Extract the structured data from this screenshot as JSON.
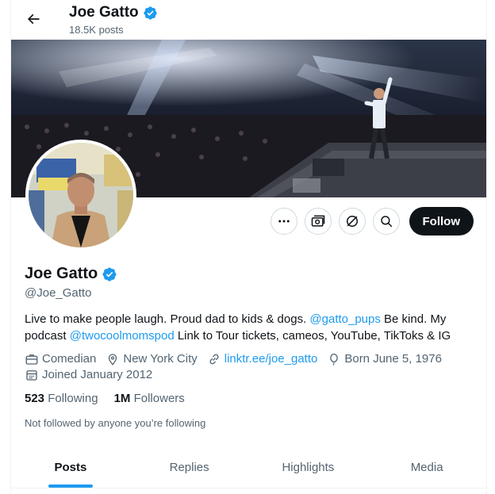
{
  "topbar": {
    "name": "Joe Gatto",
    "posts_count": "18.5K posts"
  },
  "profile": {
    "name": "Joe Gatto",
    "handle": "@Joe_Gatto",
    "bio": {
      "part1": "Live to make people laugh. Proud dad to kids & dogs. ",
      "mention1": "@gatto_pups",
      "part2": " Be kind. My podcast ",
      "mention2": "@twocoolmomspod",
      "part3": " Link to Tour tickets, cameos, YouTube, TikToks & IG"
    },
    "meta": {
      "category": "Comedian",
      "location": "New York City",
      "website": "linktr.ee/joe_gatto",
      "birthday": "Born June 5, 1976",
      "joined": "Joined January 2012"
    },
    "stats": {
      "following_count": "523",
      "following_label": "Following",
      "followers_count": "1M",
      "followers_label": "Followers"
    },
    "mutual_text": "Not followed by anyone you’re following"
  },
  "actions": {
    "follow_label": "Follow"
  },
  "tabs": [
    {
      "label": "Posts",
      "active": true
    },
    {
      "label": "Replies",
      "active": false
    },
    {
      "label": "Highlights",
      "active": false
    },
    {
      "label": "Media",
      "active": false
    }
  ],
  "colors": {
    "accent": "#1d9bf0",
    "text": "#0f1419",
    "secondary": "#536471",
    "button_dark": "#0f1419"
  }
}
